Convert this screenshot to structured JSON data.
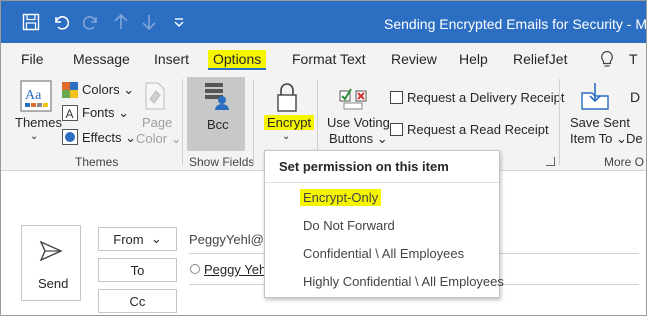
{
  "window": {
    "title": "Sending Encrypted Emails for Security  -  Message"
  },
  "menu": {
    "tabs": [
      "File",
      "Message",
      "Insert",
      "Options",
      "Format Text",
      "Review",
      "Help",
      "ReliefJet"
    ],
    "active_tab": "Options",
    "overflow_letter": "T"
  },
  "ribbon": {
    "themes": {
      "themes_label": "Themes",
      "colors_label": "Colors",
      "fonts_label": "Fonts",
      "effects_label": "Effects",
      "page_color_line1": "Page",
      "page_color_line2": "Color",
      "group_label": "Themes"
    },
    "show_fields": {
      "bcc_label": "Bcc",
      "group_label": "Show Fields"
    },
    "encrypt": {
      "label": "Encrypt"
    },
    "tracking": {
      "voting_line1": "Use Voting",
      "voting_line2": "Buttons",
      "delivery_receipt": "Request a Delivery Receipt",
      "read_receipt": "Request a Read Receipt"
    },
    "more": {
      "save_sent_line1": "Save Sent",
      "save_sent_line2": "Item To",
      "partial_d": "D",
      "partial_de": "De",
      "group_label": "More O"
    }
  },
  "compose": {
    "send_label": "Send",
    "from_label": "From",
    "from_value": "PeggyYehl@ve",
    "to_label": "To",
    "to_value": "Peggy Yehl",
    "cc_label": "Cc"
  },
  "encrypt_menu": {
    "title": "Set permission on this item",
    "items": [
      "Encrypt-Only",
      "Do Not Forward",
      "Confidential \\ All Employees",
      "Highly Confidential \\ All Employees"
    ],
    "highlighted_item": "Encrypt-Only"
  },
  "colors": {
    "titlebar": "#2b6ec2",
    "highlight": "#f5f500",
    "ribbon_bg": "#f3f3f3"
  }
}
